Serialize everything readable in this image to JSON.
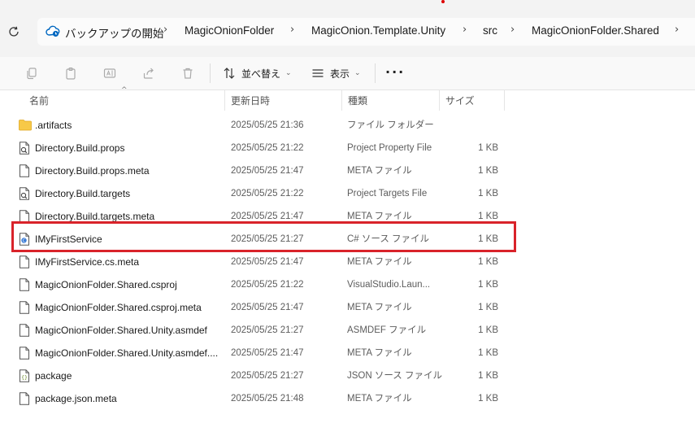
{
  "breadcrumb": [
    "バックアップの開始",
    "MagicOnionFolder",
    "MagicOnion.Template.Unity",
    "src",
    "MagicOnionFolder.Shared"
  ],
  "toolbar": {
    "sort_label": "並べ替え",
    "view_label": "表示",
    "more_label": "···"
  },
  "columns": {
    "name": "名前",
    "modified": "更新日時",
    "type": "種類",
    "size": "サイズ"
  },
  "files": [
    {
      "name": ".artifacts",
      "modified": "2025/05/25 21:36",
      "type": "ファイル フォルダー",
      "size": "",
      "icon": "folder-icon"
    },
    {
      "name": "Directory.Build.props",
      "modified": "2025/05/25 21:22",
      "type": "Project Property File",
      "size": "1 KB",
      "icon": "project-file-icon"
    },
    {
      "name": "Directory.Build.props.meta",
      "modified": "2025/05/25 21:47",
      "type": "META ファイル",
      "size": "1 KB",
      "icon": "file-icon"
    },
    {
      "name": "Directory.Build.targets",
      "modified": "2025/05/25 21:22",
      "type": "Project Targets File",
      "size": "1 KB",
      "icon": "project-file-icon"
    },
    {
      "name": "Directory.Build.targets.meta",
      "modified": "2025/05/25 21:47",
      "type": "META ファイル",
      "size": "1 KB",
      "icon": "file-icon"
    },
    {
      "name": "IMyFirstService",
      "modified": "2025/05/25 21:27",
      "type": "C# ソース ファイル",
      "size": "1 KB",
      "icon": "csharp-file-icon"
    },
    {
      "name": "IMyFirstService.cs.meta",
      "modified": "2025/05/25 21:47",
      "type": "META ファイル",
      "size": "1 KB",
      "icon": "file-icon"
    },
    {
      "name": "MagicOnionFolder.Shared.csproj",
      "modified": "2025/05/25 21:22",
      "type": "VisualStudio.Laun...",
      "size": "1 KB",
      "icon": "file-icon"
    },
    {
      "name": "MagicOnionFolder.Shared.csproj.meta",
      "modified": "2025/05/25 21:47",
      "type": "META ファイル",
      "size": "1 KB",
      "icon": "file-icon"
    },
    {
      "name": "MagicOnionFolder.Shared.Unity.asmdef",
      "modified": "2025/05/25 21:27",
      "type": "ASMDEF ファイル",
      "size": "1 KB",
      "icon": "file-icon"
    },
    {
      "name": "MagicOnionFolder.Shared.Unity.asmdef....",
      "modified": "2025/05/25 21:47",
      "type": "META ファイル",
      "size": "1 KB",
      "icon": "file-icon"
    },
    {
      "name": "package",
      "modified": "2025/05/25 21:27",
      "type": "JSON ソース ファイル",
      "size": "1 KB",
      "icon": "json-file-icon"
    },
    {
      "name": "package.json.meta",
      "modified": "2025/05/25 21:48",
      "type": "META ファイル",
      "size": "1 KB",
      "icon": "file-icon"
    }
  ],
  "colors": {
    "highlight": "#d9232a",
    "folder": "#f7c948",
    "accent": "#0067c0"
  }
}
